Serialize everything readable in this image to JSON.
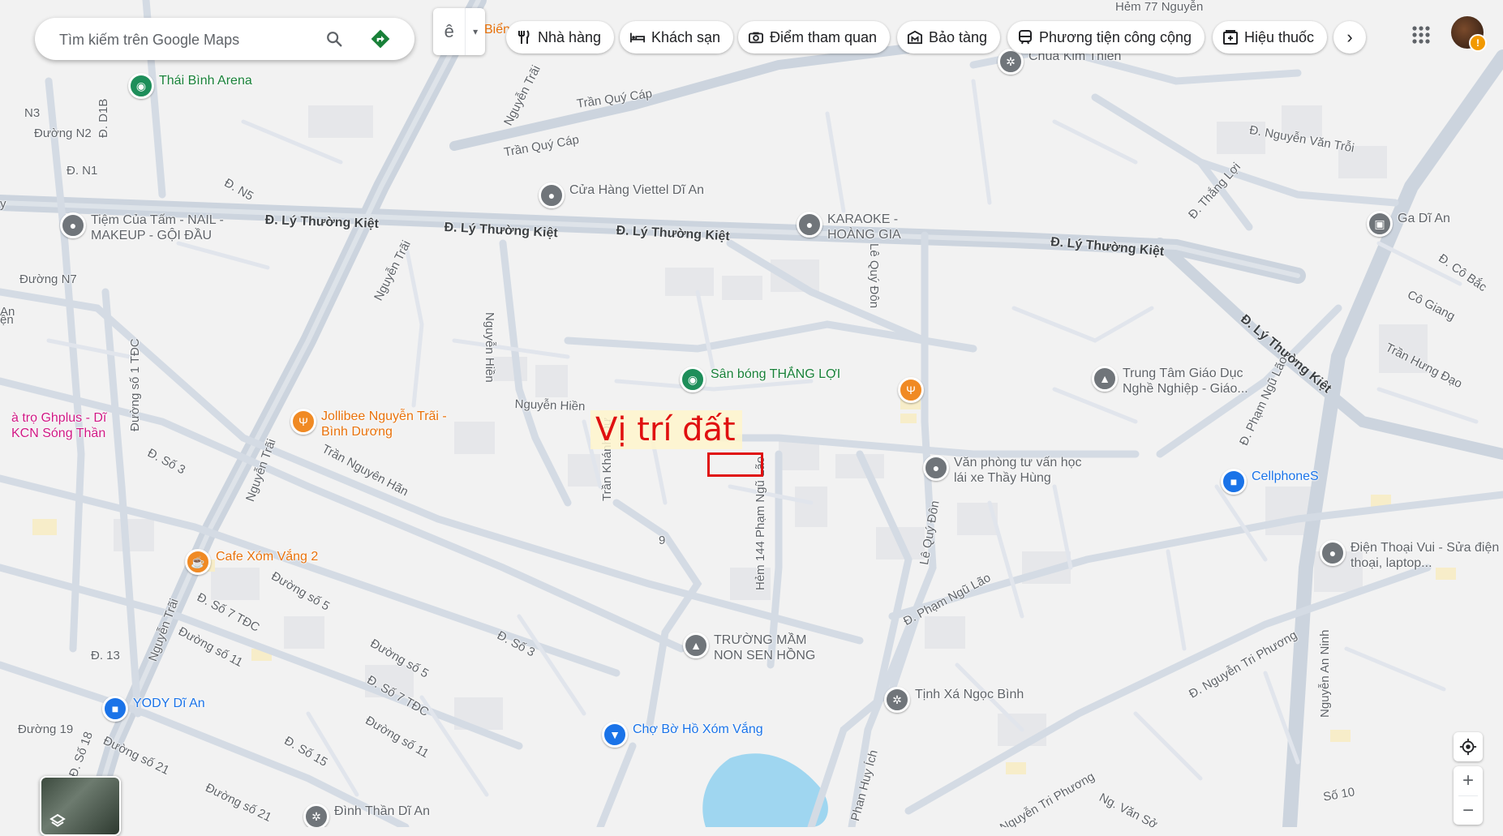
{
  "search": {
    "placeholder": "Tìm kiếm trên Google Maps"
  },
  "toolbar": {
    "mode_glyph": "ê",
    "mode_dropdown": "▾",
    "truncated_label": "Biển"
  },
  "chips": [
    {
      "label": "Nhà hàng",
      "icon": "restaurant-icon"
    },
    {
      "label": "Khách sạn",
      "icon": "hotel-icon"
    },
    {
      "label": "Điểm tham quan",
      "icon": "camera-icon"
    },
    {
      "label": "Bảo tàng",
      "icon": "museum-icon"
    },
    {
      "label": "Phương tiện công cộng",
      "icon": "transit-icon"
    },
    {
      "label": "Hiệu thuốc",
      "icon": "pharmacy-icon"
    }
  ],
  "more_label": "›",
  "account": {
    "warning": "!"
  },
  "zoom": {
    "in": "+",
    "out": "−"
  },
  "marker": {
    "label": "Vị trí đất",
    "color": "#e01010"
  },
  "roads": [
    {
      "name": "Trần Quý Cáp"
    },
    {
      "name": "Trần Quý Cáp"
    },
    {
      "name": "Nguyễn Trãi"
    },
    {
      "name": "Nguyễn Trãi"
    },
    {
      "name": "Nguyễn Trãi"
    },
    {
      "name": "Nguyễn Trãi"
    },
    {
      "name": "Đ. Lý Thường Kiệt"
    },
    {
      "name": "Đ. Lý Thường Kiệt"
    },
    {
      "name": "Đ. Lý Thường Kiệt"
    },
    {
      "name": "Đ. Lý Thường Kiệt"
    },
    {
      "name": "Đ. Lý Thường Kiệt"
    },
    {
      "name": "Đ. N5"
    },
    {
      "name": "Đ. N1"
    },
    {
      "name": "Đường N2"
    },
    {
      "name": "Đường N7"
    },
    {
      "name": "Đ. D1B"
    },
    {
      "name": "Đường số 1 TĐC"
    },
    {
      "name": "Đ. Số 3"
    },
    {
      "name": "Đ. Số 3"
    },
    {
      "name": "Nguyễn Hiền"
    },
    {
      "name": "Nguyễn Hiền"
    },
    {
      "name": "Trần Nguyên Hãn"
    },
    {
      "name": "Trần Khánh Dư"
    },
    {
      "name": "Hẻm 144 Phạm Ngũ Lão"
    },
    {
      "name": "Lê Quý Đôn"
    },
    {
      "name": "Lê Quý Đôn"
    },
    {
      "name": "Đ. Phạm Ngũ Lão"
    },
    {
      "name": "Đ. Phạm Ngũ Lão"
    },
    {
      "name": "Đường số 5"
    },
    {
      "name": "Đường số 5"
    },
    {
      "name": "Đ. Số 7 TĐC"
    },
    {
      "name": "Đ. Số 7 TĐC"
    },
    {
      "name": "Đường số 11"
    },
    {
      "name": "Đường số 11"
    },
    {
      "name": "Đ. 13"
    },
    {
      "name": "Đường 19"
    },
    {
      "name": "Đường số 21"
    },
    {
      "name": "Đường số 21"
    },
    {
      "name": "Đ. Số 15"
    },
    {
      "name": "Đ. Số 18"
    },
    {
      "name": "Phan Huy Ích"
    },
    {
      "name": "Đ. Nguyễn Tri Phương"
    },
    {
      "name": "Nguyễn Tri Phương"
    },
    {
      "name": "Ng. Văn Sở"
    },
    {
      "name": "Nguyễn An Ninh"
    },
    {
      "name": "Số 10"
    },
    {
      "name": "Trần Hưng Đạo"
    },
    {
      "name": "Cô Giang"
    },
    {
      "name": "Đ. Cô Bắc"
    },
    {
      "name": "Đ. Thắng Lợi"
    },
    {
      "name": "Đ. Nguyễn Văn Trỗi"
    },
    {
      "name": "Hẻm 77 Nguyễn"
    },
    {
      "name": "9"
    },
    {
      "name": "N3"
    },
    {
      "name": "y"
    },
    {
      "name": "An"
    },
    {
      "name": "ện"
    }
  ],
  "pois": [
    {
      "name": "Thái Bình Arena",
      "type": "green",
      "icon": "stadium-pin-icon"
    },
    {
      "name": "Chùa Kim Thiền",
      "type": "grey",
      "icon": "temple-pin-icon"
    },
    {
      "name": "Cửa Hàng Viettel Dĩ An",
      "type": "grey",
      "icon": "place-pin-icon"
    },
    {
      "name": "Tiệm Của Tấm - NAIL - MAKEUP - GỘI ĐẦU",
      "type": "grey",
      "icon": "place-pin-icon"
    },
    {
      "name": "KARAOKE - HOÀNG GIA",
      "type": "grey",
      "icon": "place-pin-icon"
    },
    {
      "name": "Ga Dĩ An",
      "type": "grey",
      "icon": "train-pin-icon"
    },
    {
      "name": "Sân bóng THẮNG LỢI",
      "type": "green",
      "icon": "stadium-pin-icon"
    },
    {
      "name": "",
      "type": "orange",
      "icon": "restaurant-pin-icon"
    },
    {
      "name": "Trung Tâm Giáo Dục Nghề Nghiệp - Giáo...",
      "type": "grey",
      "icon": "school-pin-icon"
    },
    {
      "name": "Jollibee Nguyễn Trãi - Bình Dương",
      "type": "orange",
      "icon": "restaurant-pin-icon"
    },
    {
      "name": "à trọ Ghplus - Dĩ KCN Sóng Thần",
      "type": "pink",
      "icon": ""
    },
    {
      "name": "Văn phòng tư vấn học lái xe Thầy Hùng",
      "type": "grey",
      "icon": "place-pin-icon"
    },
    {
      "name": "CellphoneS",
      "type": "blue",
      "icon": "shopping-pin-icon"
    },
    {
      "name": "Điện Thoại Vui - Sửa điện thoại, laptop...",
      "type": "grey",
      "icon": "place-pin-icon"
    },
    {
      "name": "Cafe Xóm Vắng 2",
      "type": "orange",
      "icon": "cafe-pin-icon"
    },
    {
      "name": "TRƯỜNG MẦM NON SEN HỒNG",
      "type": "grey",
      "icon": "school-pin-icon"
    },
    {
      "name": "Tịnh Xá Ngọc Bình",
      "type": "grey",
      "icon": "temple-pin-icon"
    },
    {
      "name": "YODY Dĩ An",
      "type": "blue",
      "icon": "shopping-pin-icon"
    },
    {
      "name": "Chợ Bờ Hồ Xóm Vắng",
      "type": "blue",
      "icon": "cart-pin-icon"
    },
    {
      "name": "Đình Thần Dĩ An",
      "type": "grey",
      "icon": "temple-pin-icon"
    }
  ]
}
